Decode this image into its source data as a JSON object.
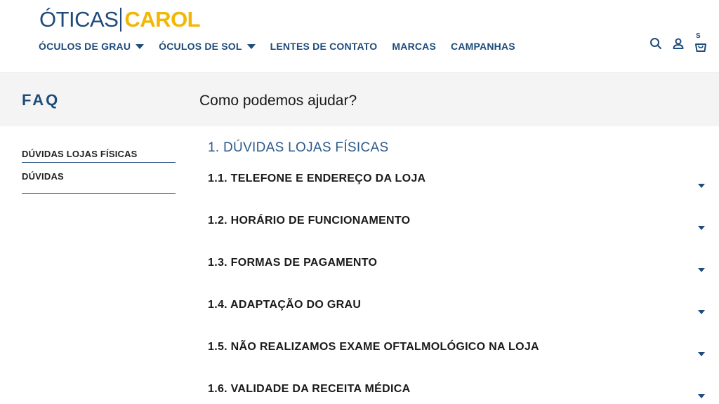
{
  "brand": {
    "part1": "ÓTICAS",
    "part2": "CAROL"
  },
  "nav": [
    {
      "label": "ÓCULOS DE GRAU",
      "has_dropdown": true
    },
    {
      "label": "ÓCULOS DE SOL",
      "has_dropdown": true
    },
    {
      "label": "LENTES DE CONTATO",
      "has_dropdown": false
    },
    {
      "label": "MARCAS",
      "has_dropdown": false
    },
    {
      "label": "CAMPANHAS",
      "has_dropdown": false
    }
  ],
  "header_icons": {
    "search": "search-icon",
    "account": "user-icon",
    "cart": "bag-icon",
    "cart_count": "S"
  },
  "band": {
    "title": "FAQ",
    "subtitle": "Como podemos ajudar?"
  },
  "sidebar": {
    "items": [
      "DÚVIDAS LOJAS FÍSICAS",
      "DÚVIDAS"
    ]
  },
  "content": {
    "section_title": "1. DÚVIDAS LOJAS FÍSICAS",
    "questions": [
      "1.1. TELEFONE E ENDEREÇO DA LOJA",
      "1.2. HORÁRIO DE FUNCIONAMENTO",
      "1.3. FORMAS DE PAGAMENTO",
      "1.4. ADAPTAÇÃO DO GRAU",
      "1.5. NÃO REALIZAMOS EXAME OFTALMOLÓGICO NA LOJA",
      "1.6. VALIDADE DA RECEITA MÉDICA"
    ]
  },
  "colors": {
    "primary": "#1e4b7a",
    "accent": "#f2b705",
    "band_bg": "#f4f4f4"
  }
}
